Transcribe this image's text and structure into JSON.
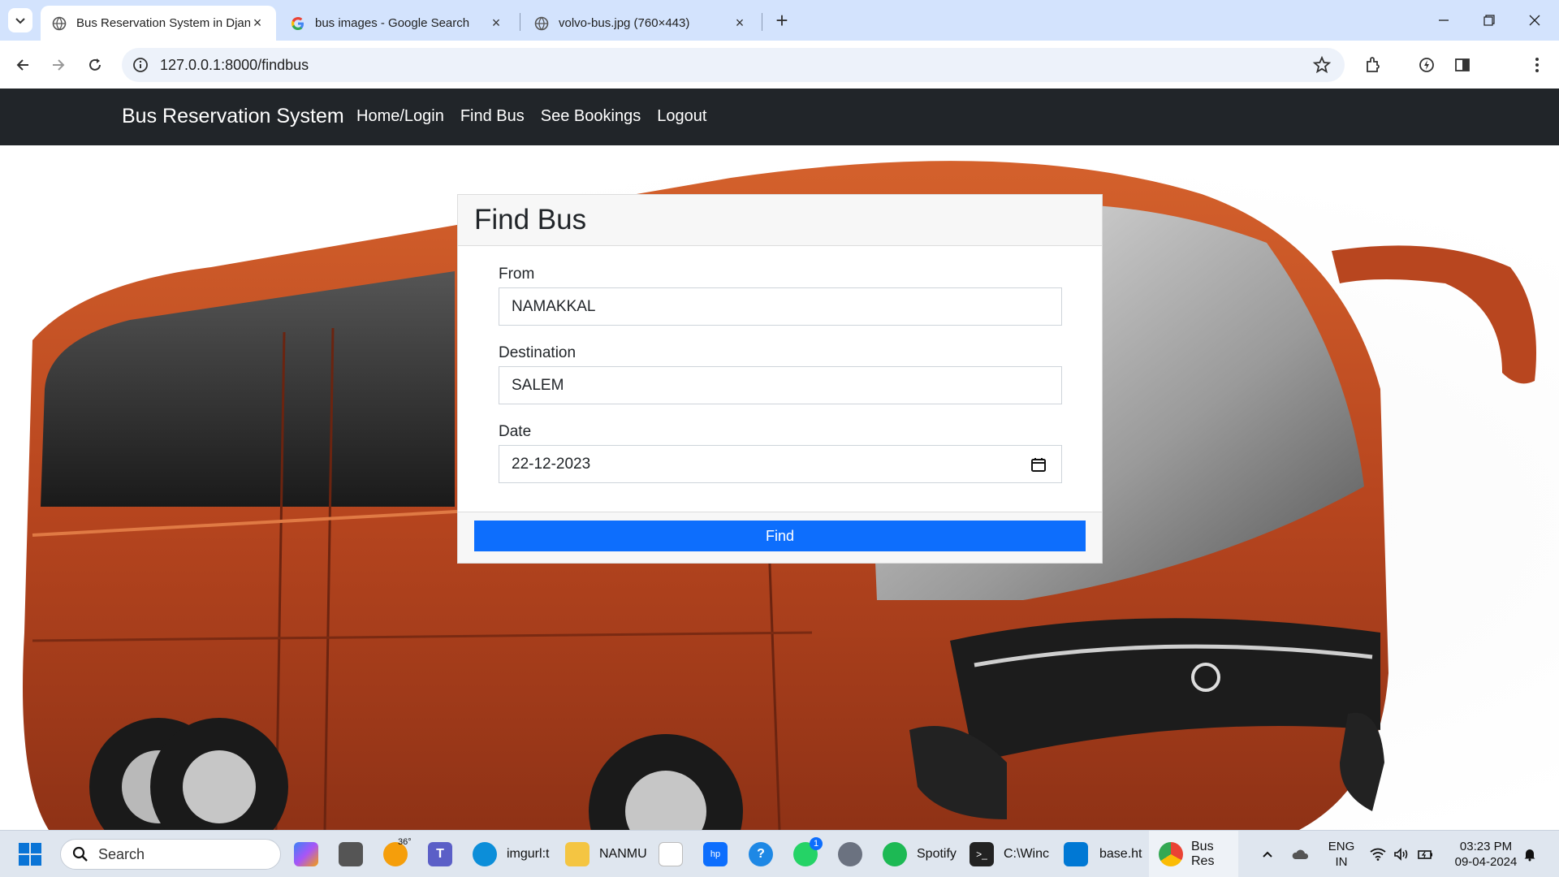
{
  "browser": {
    "tabs": [
      {
        "title": "Bus Reservation System in Djan",
        "active": true
      },
      {
        "title": "bus images - Google Search",
        "active": false
      },
      {
        "title": "volvo-bus.jpg (760×443)",
        "active": false
      }
    ],
    "url": "127.0.0.1:8000/findbus"
  },
  "navbar": {
    "brand": "Bus Reservation System",
    "links": [
      "Home/Login",
      "Find Bus",
      "See Bookings",
      "Logout"
    ]
  },
  "form": {
    "title": "Find Bus",
    "fields": [
      {
        "label": "From",
        "value": "NAMAKKAL"
      },
      {
        "label": "Destination",
        "value": "SALEM"
      },
      {
        "label": "Date",
        "value": "22-12-2023"
      }
    ],
    "submit_label": "Find"
  },
  "colors": {
    "navbar_bg": "#212529",
    "primary_button": "#0d6efd",
    "bus_orange": "#b8461f"
  },
  "taskbar": {
    "search_placeholder": "Search",
    "weather": "36°",
    "items": [
      "imgurl:t",
      "NANMU",
      "Spotify",
      "C:\\Winc",
      "base.ht",
      "Bus Res"
    ],
    "badge_whatsapp": "1",
    "language": "ENG",
    "region": "IN",
    "time": "03:23 PM",
    "date": "09-04-2024"
  }
}
